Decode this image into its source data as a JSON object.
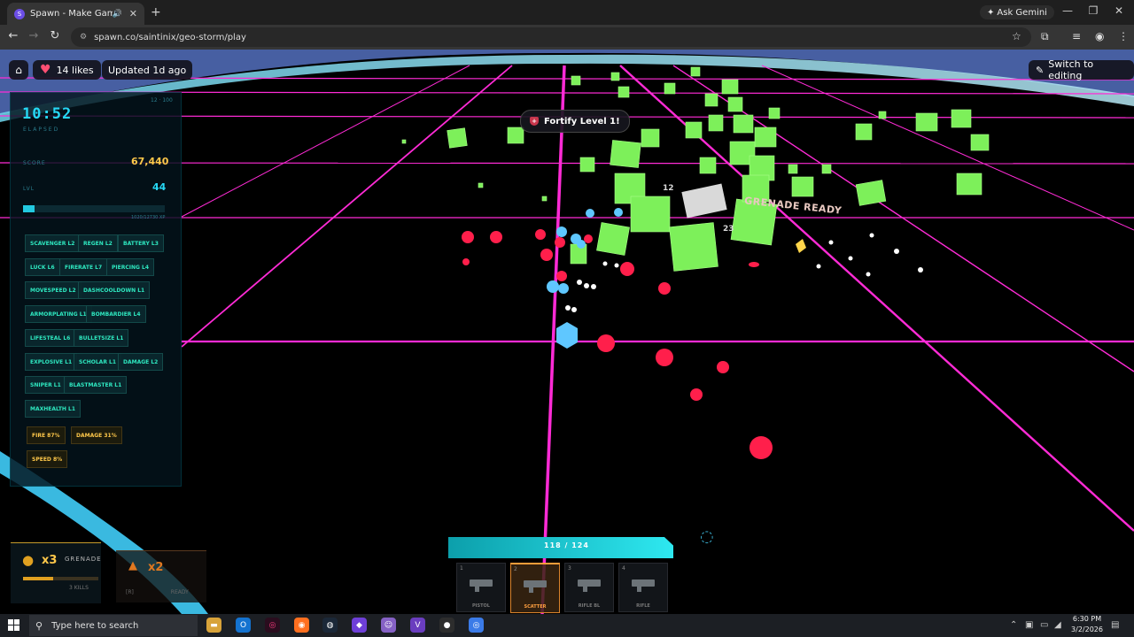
{
  "browser": {
    "tab_title": "Spawn - Make Games with",
    "tab_favicon": "S",
    "url": "spawn.co/saintinix/geo-storm/play",
    "ask_gemini_label": "Ask Gemini"
  },
  "game_header": {
    "likes_label": "14 likes",
    "updated_label": "Updated 1d ago",
    "switch_label": "Switch to editing"
  },
  "notification": {
    "text": "Fortify Level 1!"
  },
  "stats": {
    "timer": "10:52",
    "elapsed_label": "ELAPSED",
    "top_right_small": "12 · 100",
    "score_label": "SCORE",
    "score_value": "67,440",
    "level_label": "LVL",
    "level_value": "44",
    "xp_text": "1020/12730 XP",
    "xp_fraction": 0.08
  },
  "upgrades": [
    {
      "label": "SCAVENGER L2"
    },
    {
      "label": "REGEN L2"
    },
    {
      "label": "BATTERY L3"
    },
    {
      "label": "LUCK L6"
    },
    {
      "label": "FIRERATE L7"
    },
    {
      "label": "PIERCING L4"
    },
    {
      "label": "MOVESPEED L2"
    },
    {
      "label": "DASHCOOLDOWN L1"
    },
    {
      "label": "ARMORPLATING L1"
    },
    {
      "label": "BOMBARDIER L4"
    },
    {
      "label": "LIFESTEAL L6"
    },
    {
      "label": "BULLETSIZE L1"
    },
    {
      "label": "EXPLOSIVE L1"
    },
    {
      "label": "SCHOLAR L1"
    },
    {
      "label": "DAMAGE L2"
    },
    {
      "label": "SNIPER L1"
    },
    {
      "label": "BLASTMASTER L1"
    },
    {
      "label": "MAXHEALTH L1"
    }
  ],
  "bonuses": [
    {
      "label": "FIRE 87%"
    },
    {
      "label": "DAMAGE 31%"
    },
    {
      "label": "SPEED 8%"
    }
  ],
  "grenade": {
    "count": "x3",
    "label": "GRENADE",
    "kills": "3 KILLS",
    "charge_fraction": 0.4
  },
  "ability": {
    "count": "x2",
    "sub_left": "[R]",
    "sub_right": "READY"
  },
  "health": {
    "text": "118 / 124",
    "current": 118,
    "max": 124
  },
  "weapons": [
    {
      "num": "1",
      "name": "PISTOL",
      "active": false
    },
    {
      "num": "2",
      "name": "SCATTER",
      "active": true
    },
    {
      "num": "3",
      "name": "RIFLE BL",
      "active": false
    },
    {
      "num": "4",
      "name": "RIFLE",
      "active": false
    }
  ],
  "floating_text": {
    "grenade_ready": "GRENADE READY",
    "damage_number": "12",
    "damage_number_2": "23"
  },
  "taskbar": {
    "search_placeholder": "Type here to search",
    "time": "6:30 PM",
    "date": "3/2/2026"
  },
  "colors": {
    "grid": "#ff2bd6",
    "enemy": "#7df05a",
    "bullet": "#ff1f4b",
    "player": "#5fc7ff",
    "accent": "#26d8f5"
  }
}
